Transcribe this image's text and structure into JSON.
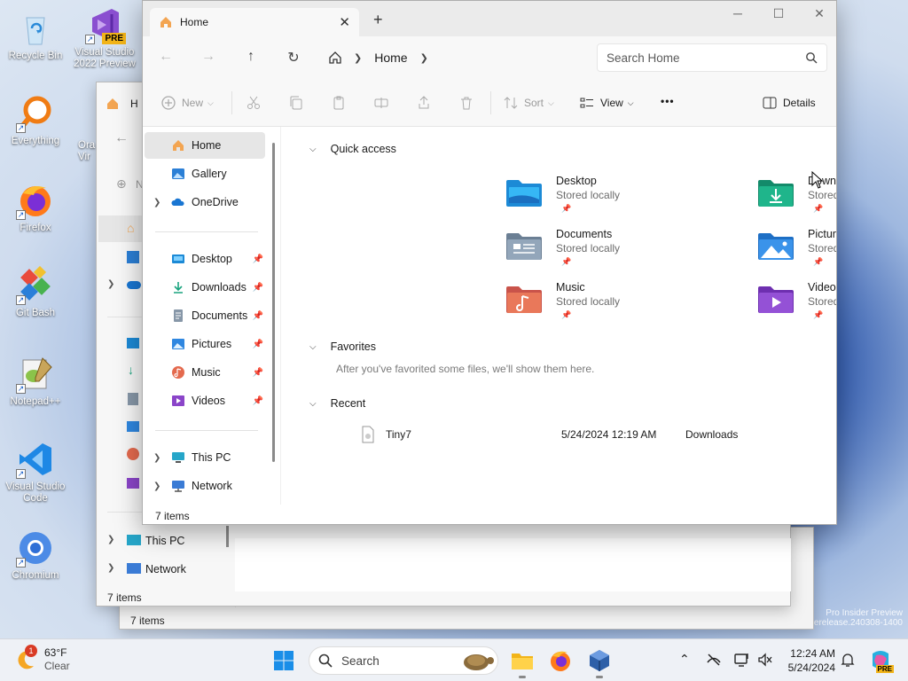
{
  "desktop": {
    "icons": [
      {
        "label": "Recycle Bin"
      },
      {
        "label": "Visual Studio 2022 Preview",
        "badge": "PRE"
      },
      {
        "label": "Everything"
      },
      {
        "label": "Firefox"
      },
      {
        "label": "Git Bash"
      },
      {
        "label": "Notepad++"
      },
      {
        "label": "Visual Studio Code"
      },
      {
        "label": "Chromium"
      }
    ],
    "watermark": {
      "line1": "Pro Insider Preview",
      "line2": "Evaluation copy. Build 26xxx.rs_prerelease.240308-1400"
    }
  },
  "bg_windows": {
    "front_tab": "H",
    "front_new": "N",
    "front_this_pc": "This PC",
    "front_network": "Network",
    "front_status": "7 items",
    "back_status": "7 items",
    "back_partial_label": "Ora Vir"
  },
  "explorer": {
    "tab_title": "Home",
    "new_tab_symbol": "+",
    "address": {
      "location": "Home"
    },
    "search": {
      "placeholder": "Search Home"
    },
    "toolbar": {
      "new_label": "New",
      "sort_label": "Sort",
      "view_label": "View",
      "more_label": "•••",
      "details_label": "Details"
    },
    "sidebar": {
      "top": [
        {
          "label": "Home"
        },
        {
          "label": "Gallery"
        },
        {
          "label": "OneDrive"
        }
      ],
      "pinned": [
        {
          "label": "Desktop"
        },
        {
          "label": "Downloads"
        },
        {
          "label": "Documents"
        },
        {
          "label": "Pictures"
        },
        {
          "label": "Music"
        },
        {
          "label": "Videos"
        }
      ],
      "bottom": [
        {
          "label": "This PC"
        },
        {
          "label": "Network"
        }
      ]
    },
    "quick_access": {
      "header": "Quick access",
      "items": [
        {
          "name": "Desktop",
          "sub": "Stored locally",
          "color": "#1c8ad6"
        },
        {
          "name": "Downloads",
          "sub": "Stored locally",
          "color": "#19a37e"
        },
        {
          "name": "Documents",
          "sub": "Stored locally",
          "color": "#7f93a8"
        },
        {
          "name": "Pictures",
          "sub": "Stored locally",
          "color": "#2f87e0"
        },
        {
          "name": "Music",
          "sub": "Stored locally",
          "color": "#e46a4e"
        },
        {
          "name": "Videos",
          "sub": "Stored locally",
          "color": "#8b45c9"
        }
      ]
    },
    "favorites": {
      "header": "Favorites",
      "hint": "After you've favorited some files, we'll show them here."
    },
    "recent": {
      "header": "Recent",
      "items": [
        {
          "name": "Tiny7",
          "date": "5/24/2024 12:19 AM",
          "location": "Downloads"
        }
      ]
    },
    "status": "7 items"
  },
  "taskbar": {
    "weather": {
      "temp": "63°F",
      "condition": "Clear",
      "alert": "1"
    },
    "search_label": "Search",
    "clock": {
      "time": "12:24 AM",
      "date": "5/24/2024"
    },
    "copilot_badge": "PRE"
  }
}
